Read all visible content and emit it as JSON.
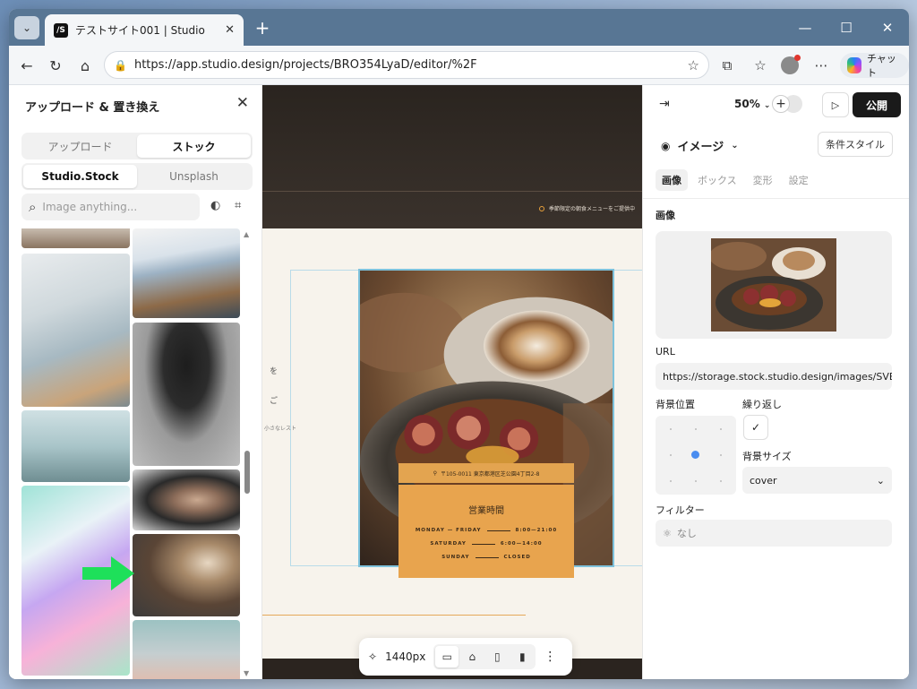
{
  "browser": {
    "tab_title": "テストサイト001 | Studio",
    "favicon_text": "/S",
    "url": "https://app.studio.design/projects/BRO354LyaD/editor/%2F",
    "chat_label": "チャット",
    "win_min": "—",
    "win_max": "☐",
    "win_close": "✕",
    "tab_close": "✕",
    "new_tab": "+",
    "tab_list": "⌄",
    "back": "←",
    "reload": "↻",
    "home": "⌂",
    "lock": "🔒",
    "star": "☆",
    "extensions": "⧉",
    "favorites": "☆",
    "more": "⋯"
  },
  "left_panel": {
    "title": "アップロード & 置き換え",
    "close": "✕",
    "tabs": [
      {
        "label": "アップロード",
        "active": false
      },
      {
        "label": "ストック",
        "active": true
      }
    ],
    "sources": [
      {
        "label": "Studio.Stock",
        "active": true
      },
      {
        "label": "Unsplash",
        "active": false
      }
    ],
    "search_placeholder": "Image anything...",
    "search_icon": "⌕",
    "palette_icon": "◐",
    "scan_icon": "⌗",
    "scroll_up": "▲",
    "scroll_down": "▼"
  },
  "canvas": {
    "notice": "季節限定の朝食メニューをご提供中",
    "address": "〒105-0011 東京都港区芝公園4丁目2-8",
    "address_icon": "⚲",
    "side_text_1": "を",
    "side_text_2": "ご",
    "small_text": "小さなレスト",
    "hours_title": "営業時間",
    "hours": [
      {
        "day": "MONDAY — FRIDAY",
        "time": "8:00—21:00"
      },
      {
        "day": "SATURDAY",
        "time": "6:00—14:00"
      },
      {
        "day": "SUNDAY",
        "time": "CLOSED"
      }
    ],
    "float_bar": {
      "ai_icon": "✧",
      "width_label": "1440px",
      "devices": [
        {
          "icon": "desktop-icon",
          "glyph": "▭",
          "active": true
        },
        {
          "icon": "laptop-icon",
          "glyph": "⌂",
          "active": false
        },
        {
          "icon": "tablet-icon",
          "glyph": "▯",
          "active": false
        },
        {
          "icon": "mobile-icon",
          "glyph": "▮",
          "active": false
        }
      ],
      "more": "⋮"
    }
  },
  "right_panel": {
    "collapse_icon": "⇥",
    "zoom": "50%",
    "zoom_caret": "⌄",
    "add": "+",
    "play": "▷",
    "publish": "公開",
    "element_icon": "◉",
    "element_type": "イメージ",
    "element_caret": "⌄",
    "conditional_style": "条件スタイル",
    "tabs": [
      {
        "label": "画像",
        "active": true
      },
      {
        "label": "ボックス",
        "active": false
      },
      {
        "label": "変形",
        "active": false
      },
      {
        "label": "設定",
        "active": false
      }
    ],
    "section_image": "画像",
    "url_label": "URL",
    "url_value": "https://storage.stock.studio.design/images/SVE",
    "bg_position_label": "背景位置",
    "repeat_label": "繰り返し",
    "repeat_check": "✓",
    "bg_size_label": "背景サイズ",
    "bg_size_value": "cover",
    "bg_size_caret": "⌄",
    "filter_label": "フィルター",
    "filter_icon": "⚛",
    "filter_value": "なし"
  },
  "colors": {
    "accent_orange": "#e8a44e",
    "selection_blue": "#7ec2dc",
    "arrow_green": "#1ee05a",
    "publish_black": "#1a1a1a"
  }
}
